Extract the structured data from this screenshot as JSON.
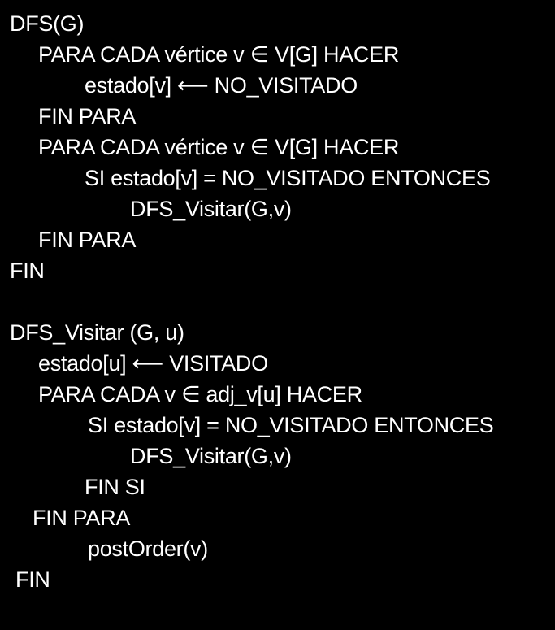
{
  "code": {
    "block1": {
      "l1": "DFS(G)",
      "l2": "PARA CADA vértice v ∈ V[G] HACER",
      "l3": "estado[v] ⟵ NO_VISITADO",
      "l4": "FIN PARA",
      "l5": "PARA CADA vértice v ∈ V[G] HACER",
      "l6": "SI estado[v] = NO_VISITADO ENTONCES",
      "l7": "DFS_Visitar(G,v)",
      "l8": "FIN PARA",
      "l9": "FIN"
    },
    "block2": {
      "l1": "DFS_Visitar (G, u)",
      "l2": "estado[u] ⟵ VISITADO",
      "l3": "PARA CADA v ∈ adj_v[u] HACER",
      "l4": "SI estado[v] = NO_VISITADO ENTONCES",
      "l5": "DFS_Visitar(G,v)",
      "l6": "FIN SI",
      "l7": "FIN PARA",
      "l8": "postOrder(v)",
      "l9": "FIN"
    }
  }
}
